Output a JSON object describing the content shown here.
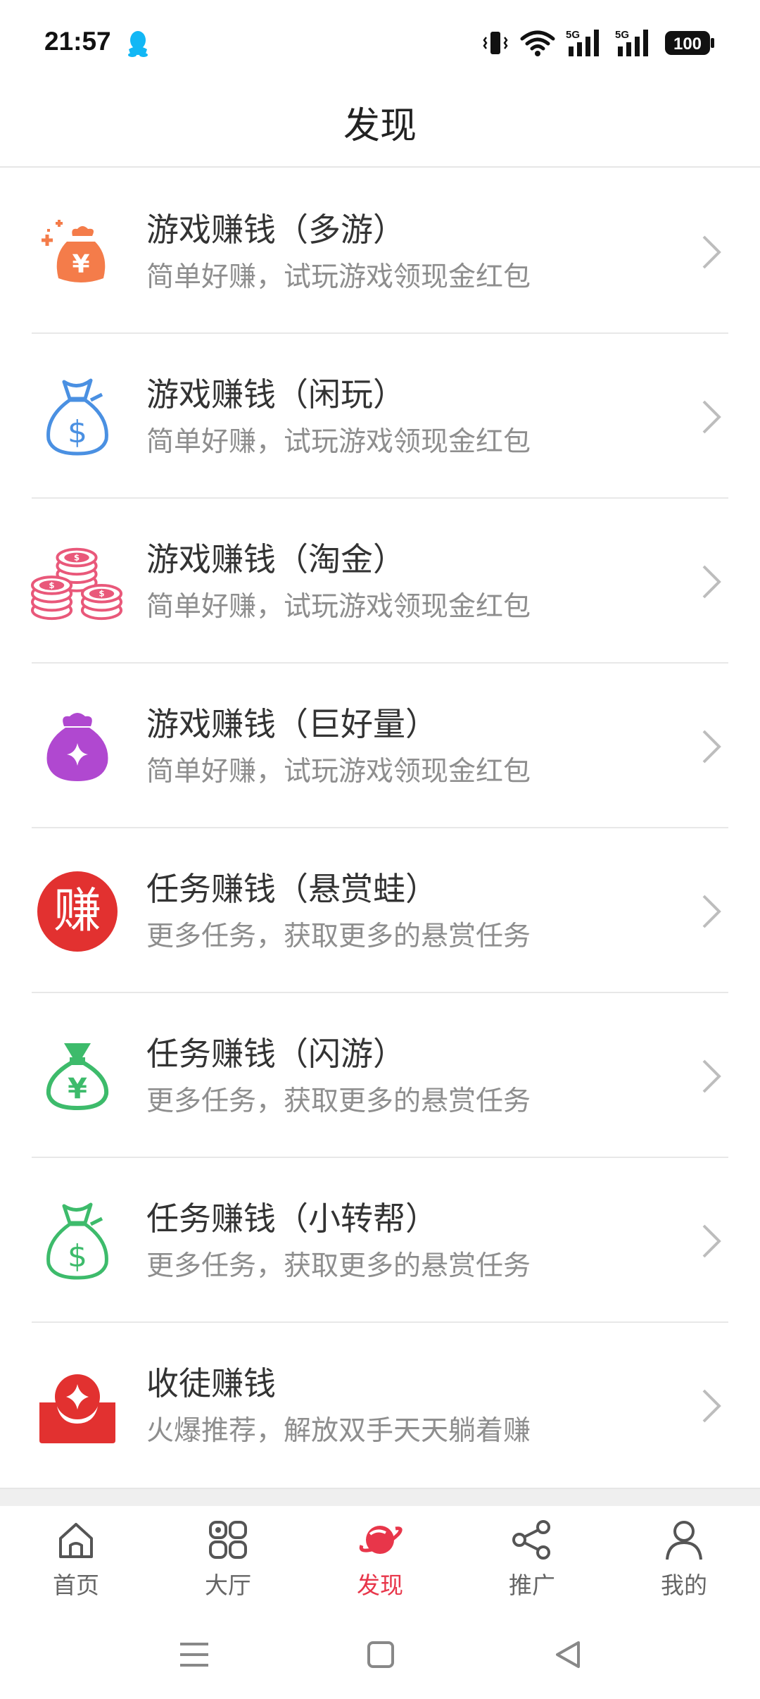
{
  "status": {
    "time": "21:57",
    "battery": "100",
    "signal1": "5G",
    "signal2": "5G"
  },
  "header": {
    "title": "发现"
  },
  "items": [
    {
      "title": "游戏赚钱（多游）",
      "subtitle": "简单好赚，试玩游戏领现金红包",
      "icon": "money-bag-yen-sparkle-icon"
    },
    {
      "title": "游戏赚钱（闲玩）",
      "subtitle": "简单好赚，试玩游戏领现金红包",
      "icon": "money-bag-dollar-icon"
    },
    {
      "title": "游戏赚钱（淘金）",
      "subtitle": "简单好赚，试玩游戏领现金红包",
      "icon": "coin-stacks-icon"
    },
    {
      "title": "游戏赚钱（巨好量）",
      "subtitle": "简单好赚，试玩游戏领现金红包",
      "icon": "purple-bag-icon"
    },
    {
      "title": "任务赚钱（悬赏蛙）",
      "subtitle": "更多任务，获取更多的悬赏任务",
      "icon": "earn-badge-icon",
      "badge_text": "赚"
    },
    {
      "title": "任务赚钱（闪游）",
      "subtitle": "更多任务，获取更多的悬赏任务",
      "icon": "green-bag-yen-icon"
    },
    {
      "title": "任务赚钱（小转帮）",
      "subtitle": "更多任务，获取更多的悬赏任务",
      "icon": "green-bag-dollar-icon"
    },
    {
      "title": "收徒赚钱",
      "subtitle": "火爆推荐，解放双手天天躺着赚",
      "icon": "red-envelope-icon"
    }
  ],
  "tabs": [
    {
      "label": "首页",
      "icon": "home-icon",
      "active": false
    },
    {
      "label": "大厅",
      "icon": "grid-icon",
      "active": false
    },
    {
      "label": "发现",
      "icon": "planet-icon",
      "active": true
    },
    {
      "label": "推广",
      "icon": "share-icon",
      "active": false
    },
    {
      "label": "我的",
      "icon": "user-icon",
      "active": false
    }
  ],
  "colors": {
    "accent": "#e8364a",
    "orange": "#f47c4a",
    "blue": "#4a90e2",
    "pink": "#e9587a",
    "purple": "#b048d0",
    "red": "#e23130",
    "green": "#3dbb6b"
  }
}
